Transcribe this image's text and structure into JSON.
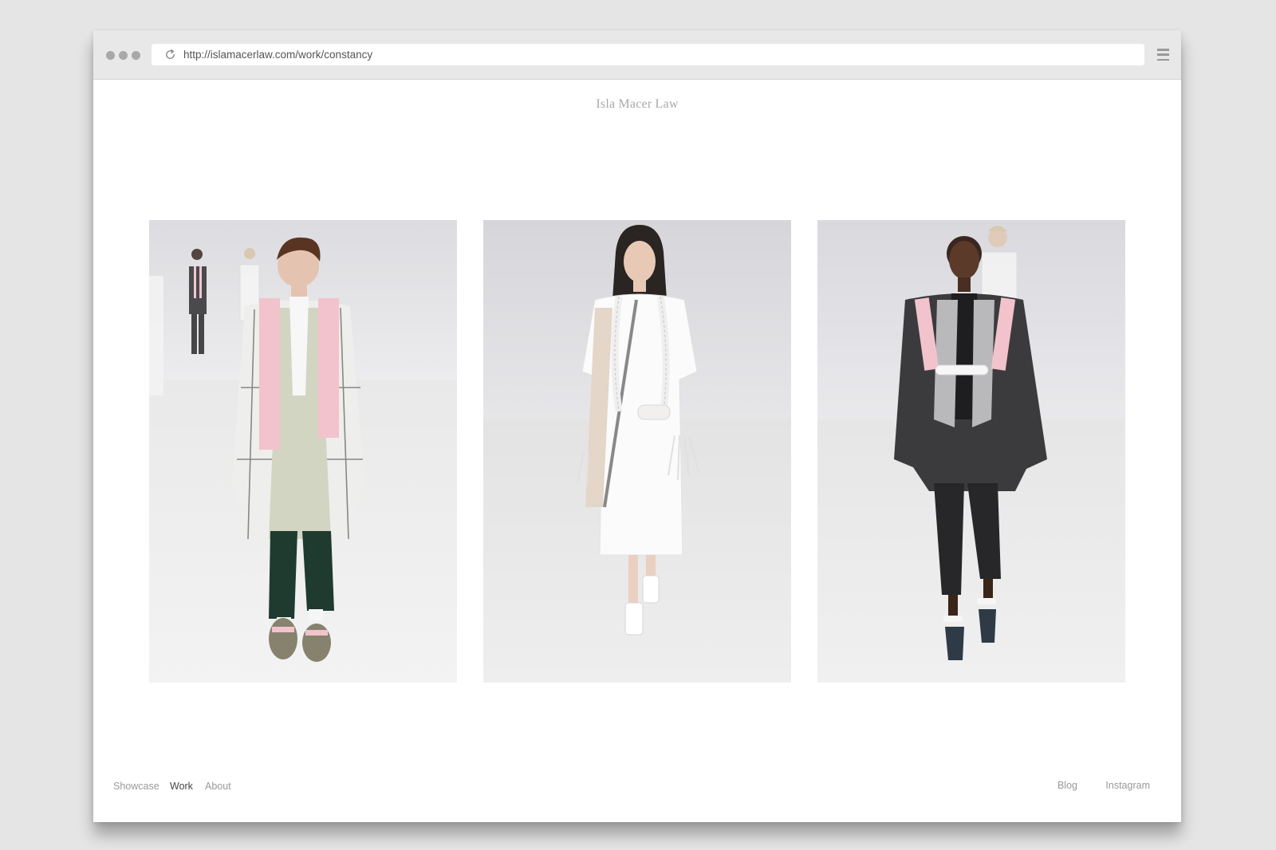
{
  "browser": {
    "url": "http://islamacerlaw.com/work/constancy"
  },
  "site": {
    "title": "Isla Macer Law"
  },
  "gallery": {
    "photos": [
      {
        "subject": "menswear look: pale sage coat, pink scarf, dark green trousers"
      },
      {
        "subject": "womenswear look: white shirt dress with rope scarf"
      },
      {
        "subject": "womenswear look: charcoal blazer with pink and grey harness scarf"
      }
    ]
  },
  "footer": {
    "nav_left": [
      "Showcase",
      "Work",
      "About"
    ],
    "active": "Work",
    "nav_right": [
      "Blog",
      "Instagram"
    ]
  },
  "colors": {
    "page_background": "#e5e5e5",
    "browser_chrome": "#e8e8e8",
    "title_grey": "#a8a8a8",
    "nav_grey": "#999999",
    "nav_active": "#444444",
    "accent_pink": "#f2c3cc"
  }
}
